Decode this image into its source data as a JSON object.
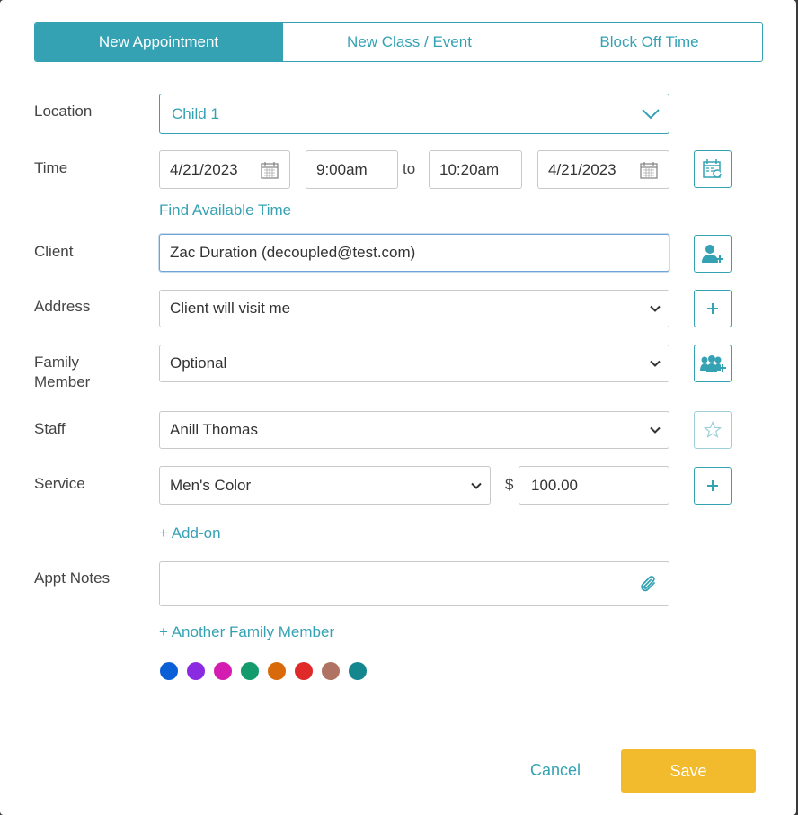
{
  "tabs": [
    {
      "label": "New Appointment",
      "active": true
    },
    {
      "label": "New Class / Event",
      "active": false
    },
    {
      "label": "Block Off Time",
      "active": false
    }
  ],
  "location": {
    "label": "Location",
    "value": "Child 1"
  },
  "time": {
    "label": "Time",
    "start_date": "4/21/2023",
    "start_time": "9:00am",
    "to": "to",
    "end_time": "10:20am",
    "end_date": "4/21/2023",
    "find_link": "Find Available Time"
  },
  "client": {
    "label": "Client",
    "value": "Zac Duration (decoupled@test.com)"
  },
  "address": {
    "label": "Address",
    "value": "Client will visit me"
  },
  "family_member": {
    "label_line1": "Family",
    "label_line2": "Member",
    "value": "Optional"
  },
  "staff": {
    "label": "Staff",
    "value": "Anill Thomas"
  },
  "service": {
    "label": "Service",
    "value": "Men's Color",
    "currency": "$",
    "price": "100.00",
    "addon_link": "+ Add-on"
  },
  "notes": {
    "label": "Appt Notes",
    "value": "",
    "another_family_link": "+ Another Family Member"
  },
  "colors": [
    "#0b5fd6",
    "#8a2be2",
    "#d41cb0",
    "#139b6e",
    "#d96a0b",
    "#e02a2a",
    "#b07262",
    "#13868e"
  ],
  "footer": {
    "cancel": "Cancel",
    "save": "Save"
  }
}
